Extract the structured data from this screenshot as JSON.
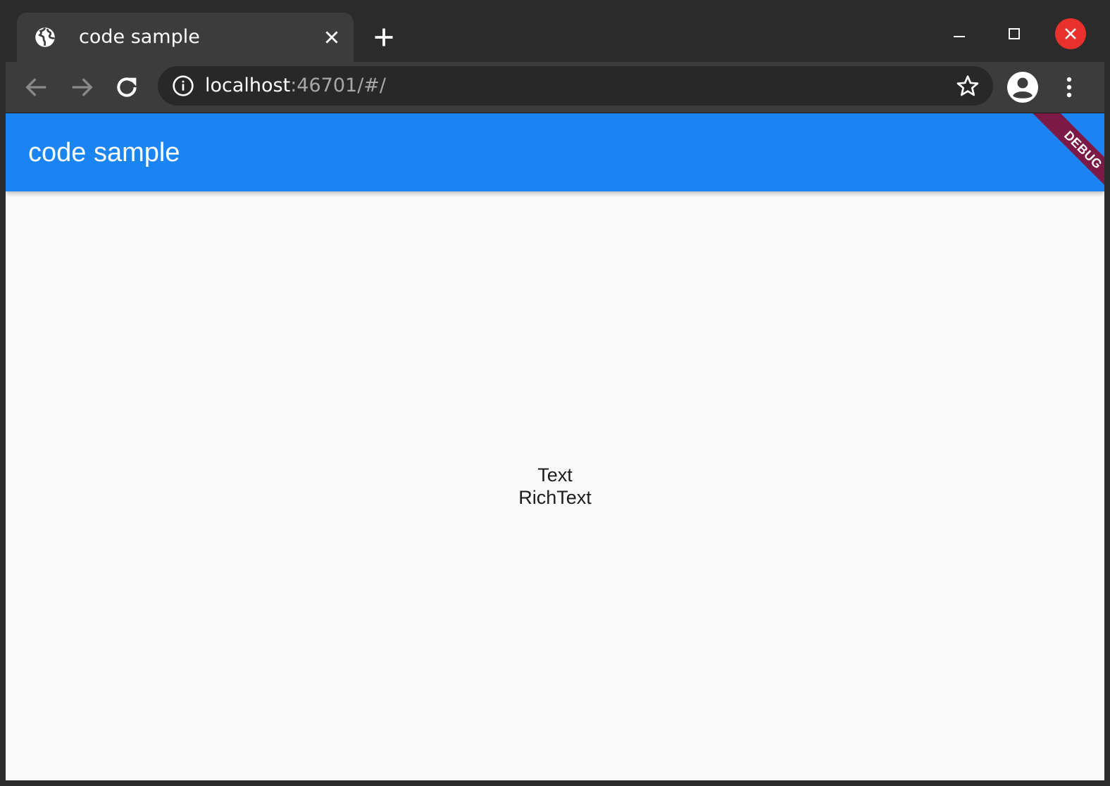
{
  "browser": {
    "tab": {
      "title": "code sample",
      "icon": "globe-icon"
    },
    "address_bar": {
      "host": "localhost",
      "rest": ":46701/#/"
    }
  },
  "app": {
    "appbar_title": "code sample",
    "debug_banner": "DEBUG",
    "body_lines": [
      "Text",
      "RichText"
    ]
  },
  "colors": {
    "appbar": "#1a84f3",
    "debug_banner": "#7b1a47",
    "close_button": "#e8312b",
    "page_background": "#fafafa"
  }
}
